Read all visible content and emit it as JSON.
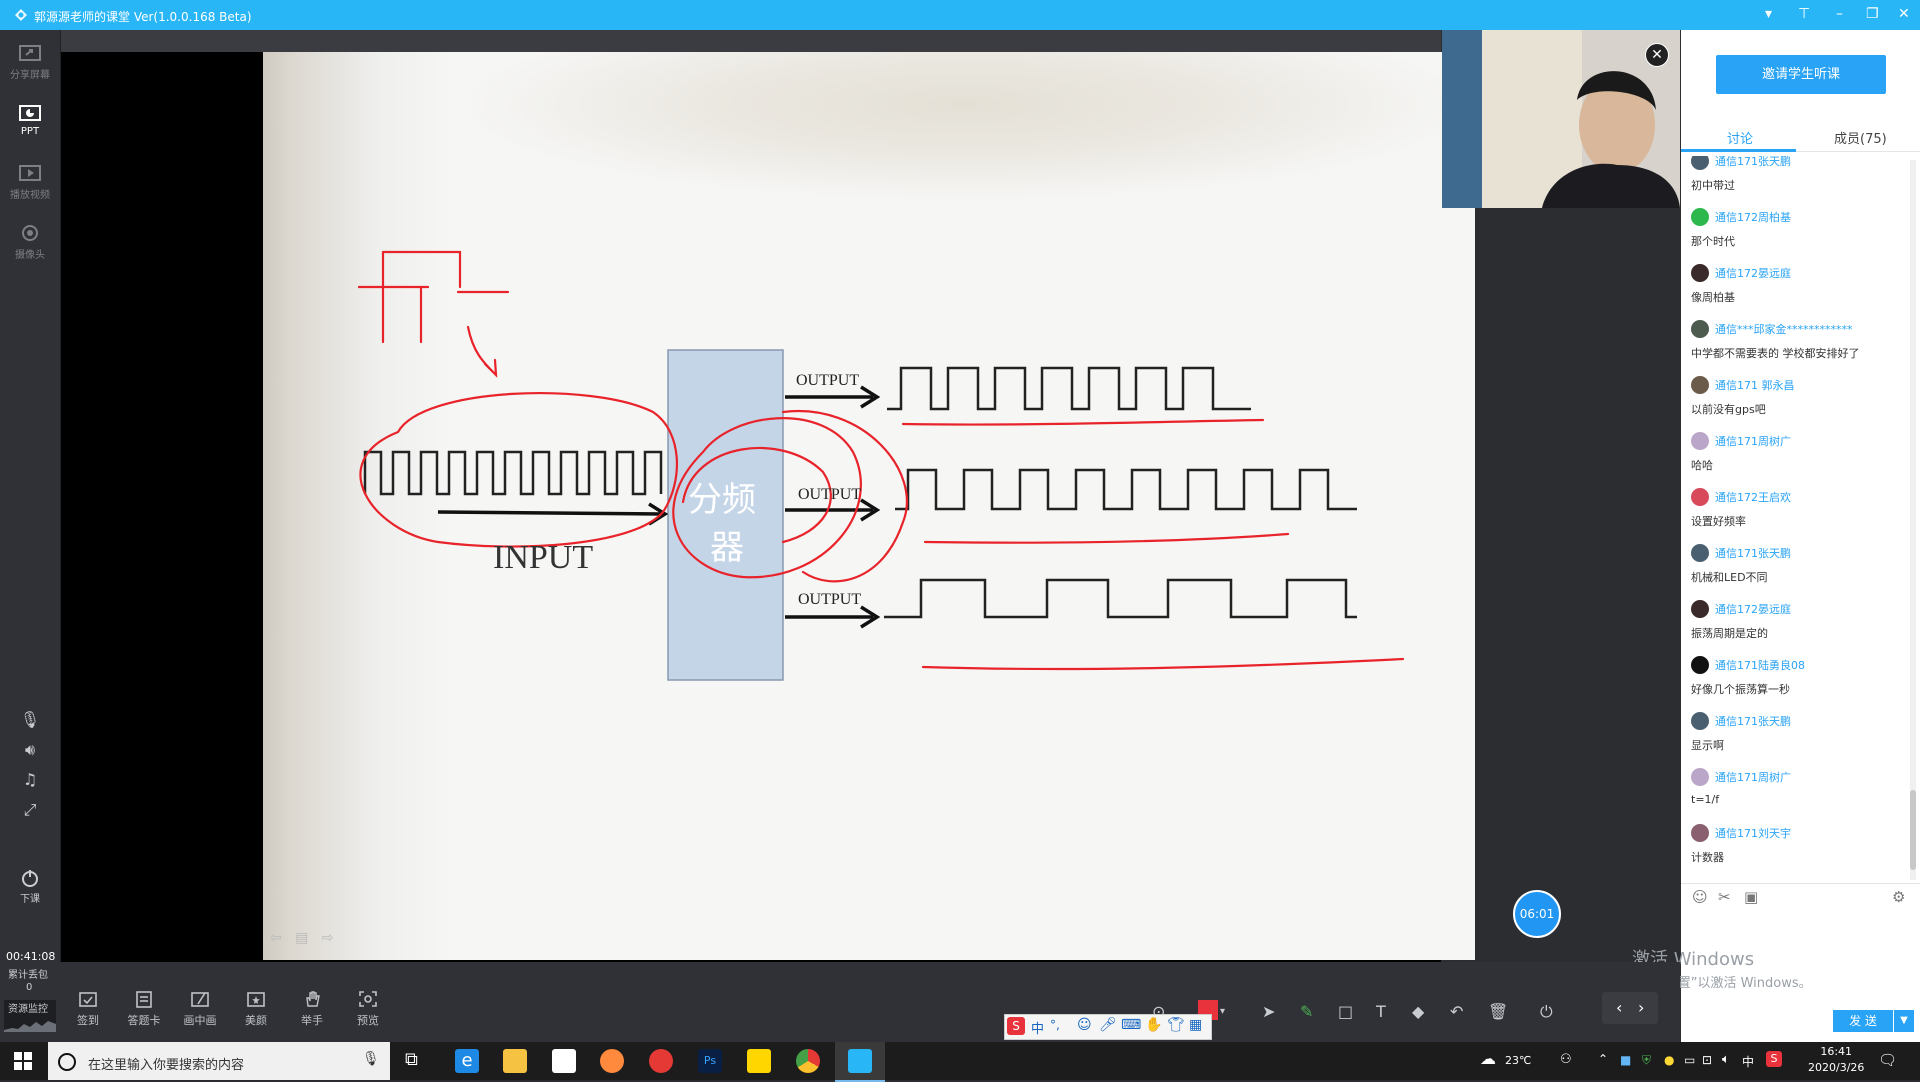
{
  "window": {
    "title": "郭源源老师的课堂 Ver(1.0.0.168 Beta)"
  },
  "left_toolbar": {
    "items": [
      {
        "label": "分享屏幕",
        "icon": "share-screen-icon"
      },
      {
        "label": "PPT",
        "icon": "ppt-icon"
      },
      {
        "label": "播放视频",
        "icon": "play-video-icon"
      },
      {
        "label": "摄像头",
        "icon": "camera-icon"
      }
    ],
    "end_class_label": "下课"
  },
  "slide": {
    "output_labels": [
      "OUTPUT",
      "OUTPUT",
      "OUTPUT"
    ],
    "input_label": "INPUT",
    "divider_label_line1": "分频",
    "divider_label_line2": "器"
  },
  "timer": "06:01",
  "right_panel": {
    "invite_button": "邀请学生听课",
    "tabs": [
      {
        "label": "讨论"
      },
      {
        "label": "成员(75)"
      }
    ],
    "messages": [
      {
        "name": "通信171张天鹏",
        "text": "初中带过",
        "avatar_color": "#4a6070"
      },
      {
        "name": "通信172周柏基",
        "text": "那个时代",
        "avatar_color": "#2db84d"
      },
      {
        "name": "通信172晏远庭",
        "text": "像周柏基",
        "avatar_color": "#3a2a2a"
      },
      {
        "name": "通信***邱家金************",
        "text": "中学都不需要表的  学校都安排好了",
        "avatar_color": "#4d5a4e"
      },
      {
        "name": "通信171 郭永昌",
        "text": "以前没有gps吧",
        "avatar_color": "#6b5b4a"
      },
      {
        "name": "通信171周树广",
        "text": "哈哈",
        "avatar_color": "#b9a6c8"
      },
      {
        "name": "通信172王启欢",
        "text": "设置好频率",
        "avatar_color": "#d84a5a"
      },
      {
        "name": "通信171张天鹏",
        "text": "机械和LED不同",
        "avatar_color": "#4a6070"
      },
      {
        "name": "通信172晏远庭",
        "text": "振荡周期是定的",
        "avatar_color": "#3a2a2a"
      },
      {
        "name": "通信171陆勇良08",
        "text": "好像几个振荡算一秒",
        "avatar_color": "#111111"
      },
      {
        "name": "通信171张天鹏",
        "text": "显示啊",
        "avatar_color": "#4a6070"
      },
      {
        "name": "通信171周树广",
        "text": "t=1/f",
        "avatar_color": "#b9a6c8"
      },
      {
        "name": "通信171刘天宇",
        "text": "计数器",
        "avatar_color": "#8a6070"
      }
    ],
    "send_button": "发 送"
  },
  "watermark": {
    "line1": "激活 Windows",
    "line2": "转到“设置”以激活 Windows。"
  },
  "bottom_toolbar": {
    "elapsed": "00:41:08",
    "loss_label": "累计丢包",
    "loss_value": "0",
    "monitor_label": "资源监控",
    "tools": [
      {
        "label": "签到",
        "icon": "checkin-icon"
      },
      {
        "label": "答题卡",
        "icon": "answer-card-icon"
      },
      {
        "label": "画中画",
        "icon": "picture-in-picture-icon"
      },
      {
        "label": "美颜",
        "icon": "beauty-icon"
      },
      {
        "label": "举手",
        "icon": "raise-hand-icon"
      },
      {
        "label": "预览",
        "icon": "preview-icon"
      }
    ]
  },
  "ime": {
    "lang": "中",
    "punct": "°,"
  },
  "taskbar": {
    "search_placeholder": "在这里输入你要搜索的内容",
    "temperature": "23℃",
    "ime_lang": "中",
    "time": "16:41",
    "date": "2020/3/26"
  }
}
